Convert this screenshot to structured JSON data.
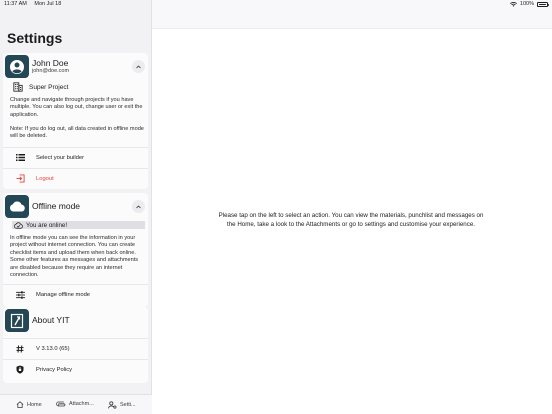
{
  "status_bar": {
    "time": "11:37 AM",
    "date": "Mon Jul 18",
    "battery": "100%",
    "icons": [
      "wifi-icon",
      "battery-icon"
    ]
  },
  "sidebar": {
    "title": "Settings",
    "account": {
      "name": "John Doe",
      "email": "john@doe.com",
      "project": "Super Project",
      "description": "Change and navigate through projects if you have multiple. You can also log out, change user or exit the application.",
      "note": "Note: If you do log out, all data created in offline mode will be deleted.",
      "select_builder": "Select your builder",
      "logout": "Logout"
    },
    "offline": {
      "title": "Offline mode",
      "status": "You are online!",
      "description": "In offline mode you can see the information in your project without internet connection. You can create checklist items and upload them when back online. Some other features as messages and attachments are disabled because they require an internet connection.",
      "manage": "Manage offline mode"
    },
    "about": {
      "title": "About YIT",
      "version": "V 3.13.0 (65)",
      "privacy": "Privacy Policy"
    }
  },
  "tabs": [
    {
      "label": "Home",
      "icon": "home-icon"
    },
    {
      "label": "Attachm...",
      "icon": "paperclip-icon"
    },
    {
      "label": "Setti...",
      "icon": "person-gear-icon"
    }
  ],
  "main": {
    "message": "Please tap on the left to select an action. You can view the materials, punchlist and messages on the Home, take a look to the Attachments or go to settings and customise your experience."
  },
  "colors": {
    "accent": "#244756",
    "logout": "#e0453a",
    "sidebar_bg": "#f2f2f5"
  }
}
